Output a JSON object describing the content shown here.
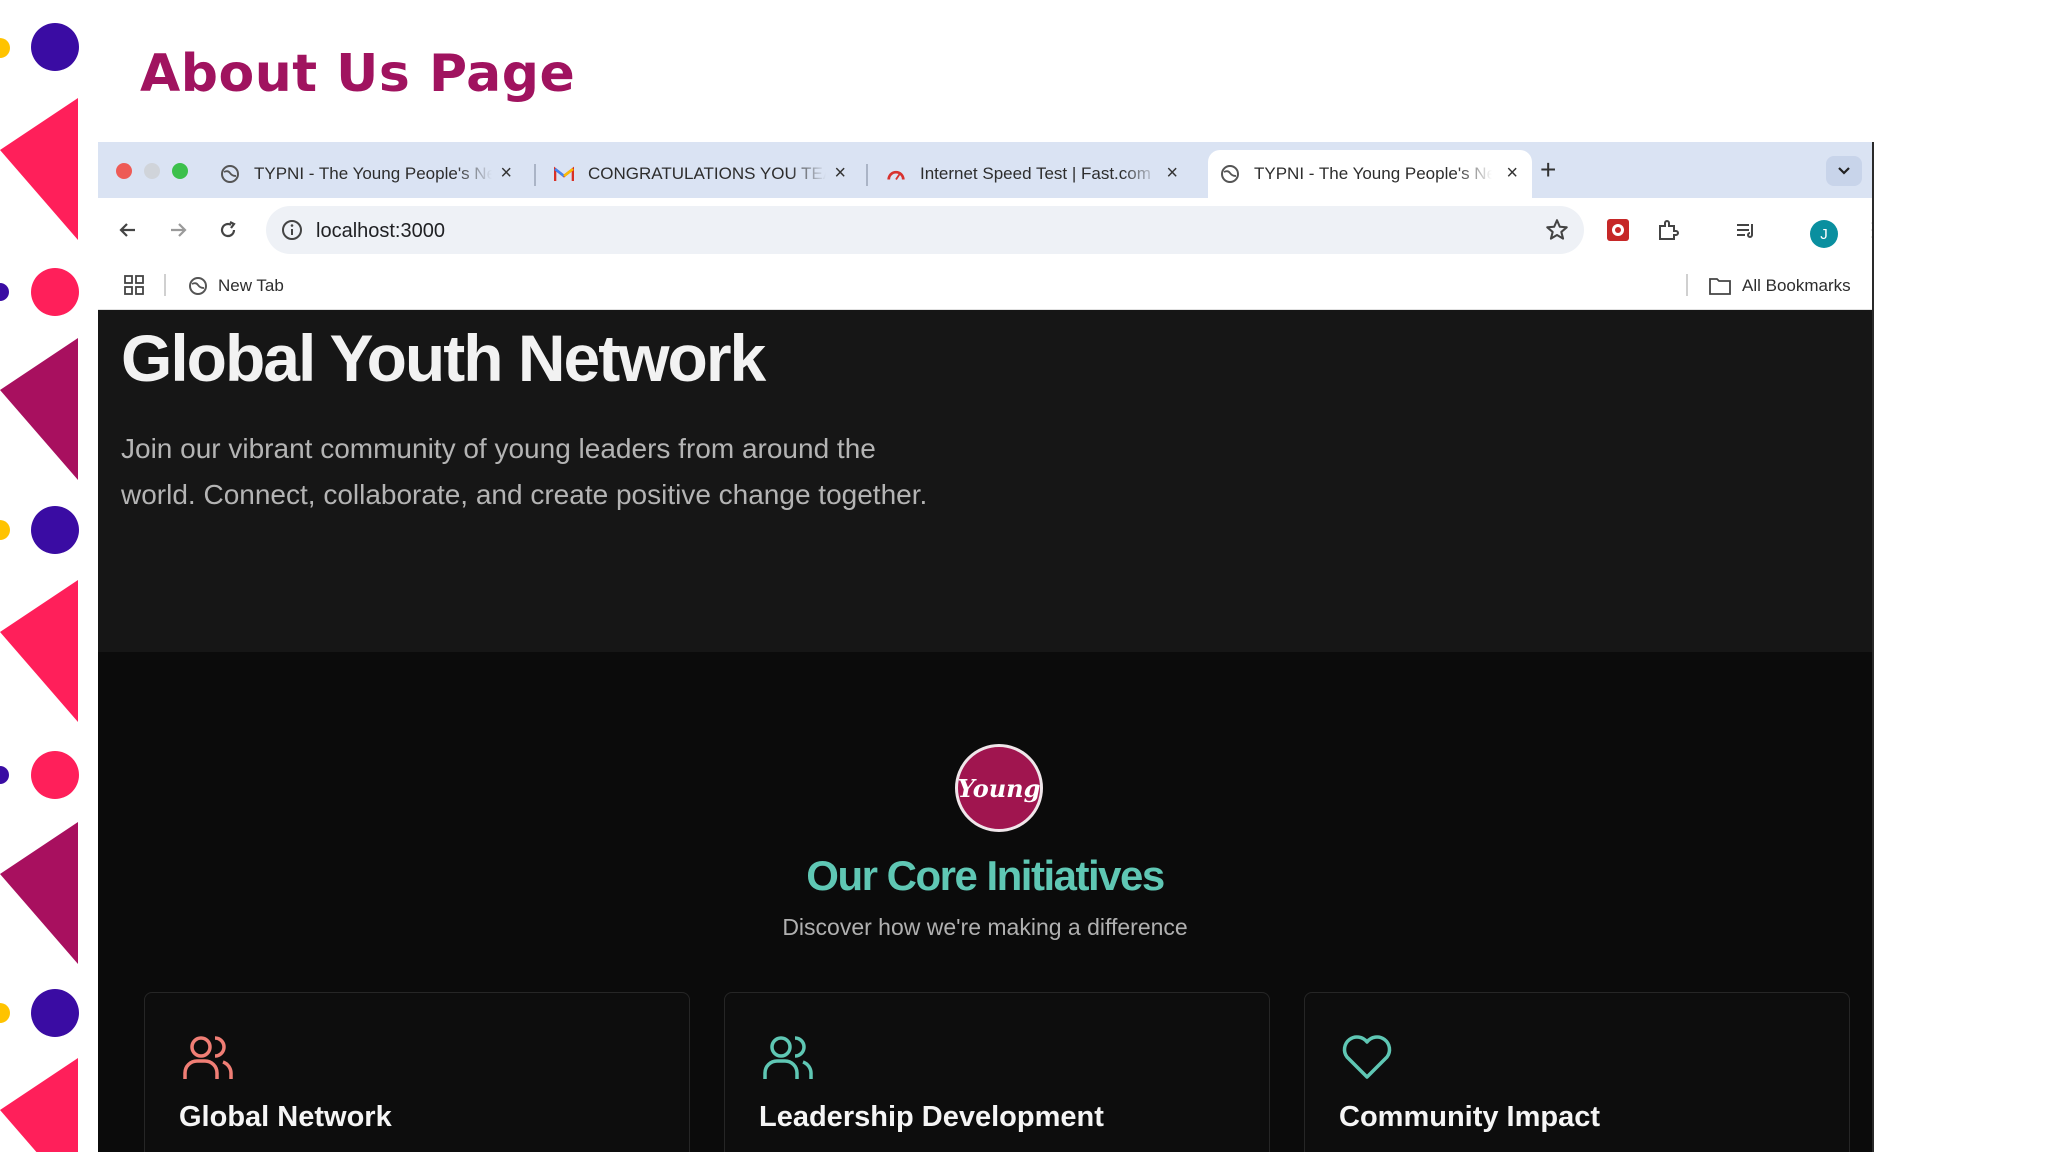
{
  "slide": {
    "title": "About Us Page"
  },
  "browser": {
    "tabs": [
      {
        "title": "TYPNI - The Young People's Network International",
        "icon": "globe-icon",
        "active": false
      },
      {
        "title": "CONGRATULATIONS YOU TEAM",
        "icon": "gmail-icon",
        "active": false
      },
      {
        "title": "Internet Speed Test | Fast.com",
        "icon": "speedometer-icon",
        "active": false
      },
      {
        "title": "TYPNI - The Young People's Network International",
        "icon": "globe-icon",
        "active": true
      }
    ],
    "url": "localhost:3000",
    "avatar_initial": "J",
    "bookmarks": {
      "new_tab": "New Tab",
      "all": "All Bookmarks"
    }
  },
  "page": {
    "hero": {
      "title": "Global Youth Network",
      "text": "Join our vibrant community of young leaders from around the world. Connect, collaborate, and create positive change together."
    },
    "initiatives": {
      "logo_text": "Young",
      "title": "Our Core Initiatives",
      "subtitle": "Discover how we're making a difference",
      "cards": [
        {
          "title": "Global Network",
          "icon": "users-icon",
          "color": "#f07e75"
        },
        {
          "title": "Leadership Development",
          "icon": "users-icon",
          "color": "#5fc7b4"
        },
        {
          "title": "Community Impact",
          "icon": "heart-icon",
          "color": "#5fc7b4"
        }
      ]
    }
  },
  "colors": {
    "accent": "#a0135f",
    "teal": "#5fc7b4",
    "coral": "#f07e75",
    "magenta": "#ff1f5a",
    "purple": "#3a0ca3"
  }
}
